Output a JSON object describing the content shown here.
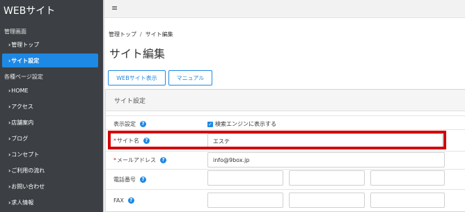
{
  "sidebar": {
    "brand": "WEBサイト",
    "section_admin": "管理画面",
    "admin_items": [
      {
        "label": "管理トップ"
      },
      {
        "label": "サイト設定"
      }
    ],
    "section_pages": "各種ページ設定",
    "page_items": [
      {
        "label": "HOME"
      },
      {
        "label": "アクセス"
      },
      {
        "label": "店舗案内"
      },
      {
        "label": "ブログ"
      },
      {
        "label": "コンセプト"
      },
      {
        "label": "ご利用の流れ"
      },
      {
        "label": "お問い合わせ"
      },
      {
        "label": "求人情報"
      }
    ],
    "chevron": "›"
  },
  "topbar": {
    "menu_icon": "≡"
  },
  "breadcrumb": {
    "items": [
      "管理トップ",
      "サイト編集"
    ],
    "separator": "/"
  },
  "page": {
    "title": "サイト編集"
  },
  "buttons": {
    "website_view": "WEBサイト表示",
    "manual": "マニュアル"
  },
  "panel": {
    "title": "サイト設定"
  },
  "form": {
    "display_label": "表示設定",
    "checkbox_label": "検索エンジンに表示する",
    "checkbox_checked": true,
    "site_name_label": "サイト名",
    "site_name_value": "エステ",
    "email_label": "メールアドレス",
    "email_value": "info@9box.jp",
    "tel_label": "電話番号",
    "fax_label": "FAX",
    "required_mark": "*",
    "help_mark": "?"
  },
  "colors": {
    "accent": "#1e88e5",
    "sidebar_bg": "#3c4044",
    "highlight": "#d40000"
  }
}
